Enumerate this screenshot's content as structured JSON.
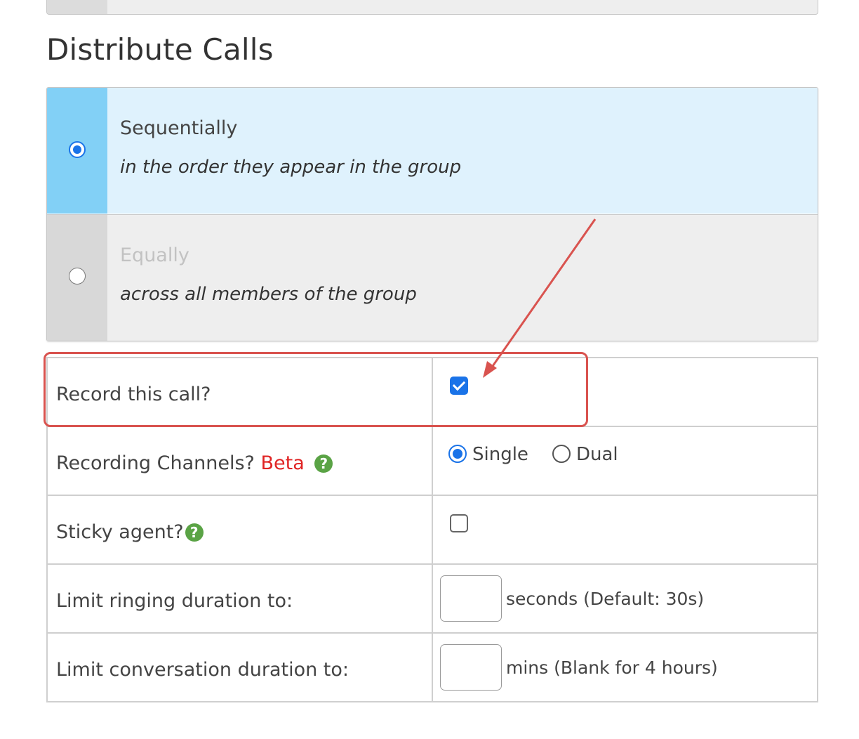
{
  "section": {
    "title": "Distribute Calls"
  },
  "distribute_options": [
    {
      "title": "Sequentially",
      "description": "in the order they appear in the group",
      "selected": true
    },
    {
      "title": "Equally",
      "description": "across all members of the group",
      "selected": false
    }
  ],
  "settings": {
    "record": {
      "label": "Record this call?",
      "checked": true
    },
    "channels": {
      "label": "Recording Channels?",
      "badge": "Beta",
      "help": "?",
      "options": [
        {
          "label": "Single",
          "selected": true
        },
        {
          "label": "Dual",
          "selected": false
        }
      ]
    },
    "sticky": {
      "label": "Sticky agent?",
      "help": "?",
      "checked": false
    },
    "ringing": {
      "label": "Limit ringing duration to:",
      "value": "",
      "unit": "seconds (Default: 30s)"
    },
    "conversation": {
      "label": "Limit conversation duration to:",
      "value": "",
      "unit": "mins (Blank for 4 hours)"
    }
  },
  "colors": {
    "selected_bg": "#dff2fd",
    "selected_radio_col": "#82d0f6",
    "accent": "#1a73e8",
    "beta": "#e02424",
    "help_icon": "#5aa345",
    "annotation": "#d9534f"
  },
  "icons": [
    "radio-icon",
    "checkbox-icon",
    "help-icon",
    "arrow-annotation"
  ]
}
